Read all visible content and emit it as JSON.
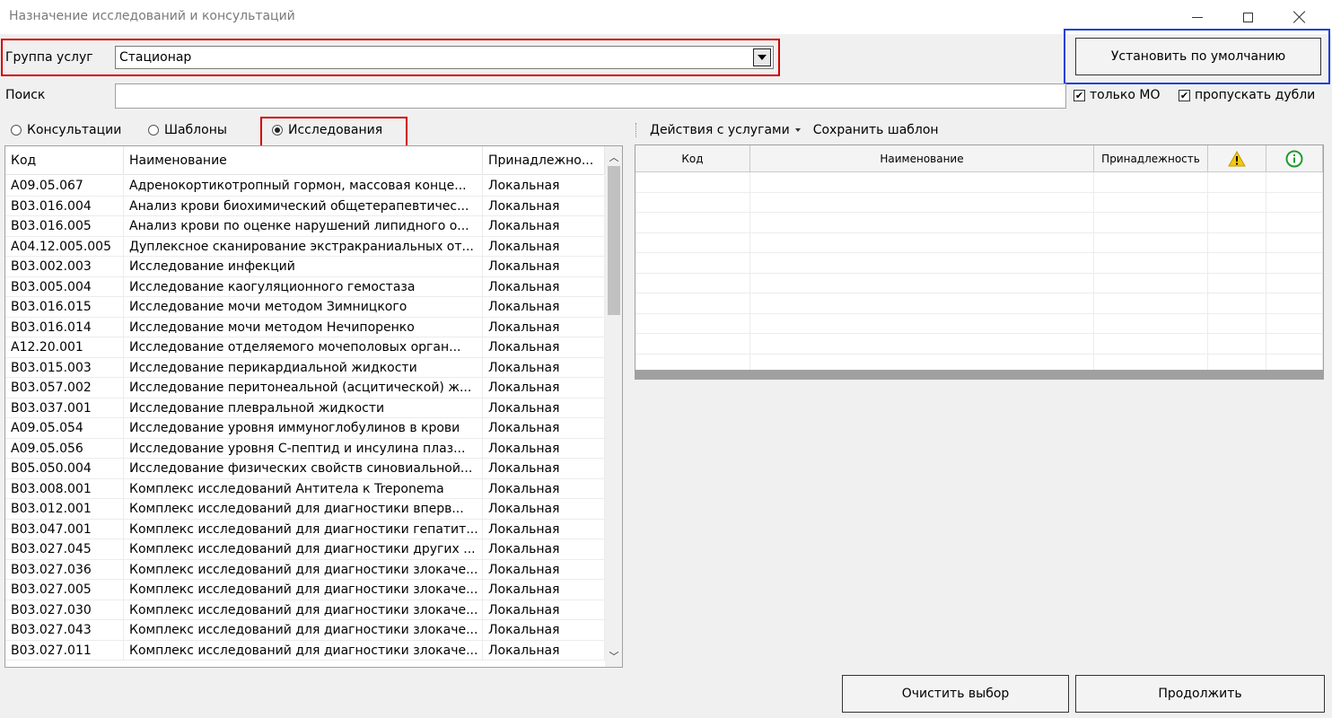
{
  "window": {
    "title": "Назначение исследований и консультаций",
    "controls": {
      "minimize": "minimize",
      "maximize": "maximize",
      "close": "close"
    }
  },
  "service_group": {
    "label": "Группа услуг",
    "value": "Стационар"
  },
  "default_button": "Установить по умолчанию",
  "search": {
    "label": "Поиск",
    "value": "",
    "only_mo": {
      "label": "только МО",
      "checked": true
    },
    "skip_duplicates": {
      "label": "пропускать дубли",
      "checked": true
    }
  },
  "tabs": [
    {
      "label": "Консультации",
      "selected": false
    },
    {
      "label": "Шаблоны",
      "selected": false
    },
    {
      "label": "Исследования",
      "selected": true
    }
  ],
  "left_table": {
    "columns": [
      "Код",
      "Наименование",
      "Принадлежно..."
    ],
    "rows": [
      [
        "A09.05.067",
        "Адренокортикотропный гормон, массовая конце...",
        "Локальная"
      ],
      [
        "B03.016.004",
        "Анализ крови биохимический общетерапевтичес...",
        "Локальная"
      ],
      [
        "B03.016.005",
        "Анализ крови по оценке нарушений липидного о...",
        "Локальная"
      ],
      [
        "A04.12.005.005",
        "Дуплексное сканирование экстракраниальных от...",
        "Локальная"
      ],
      [
        "B03.002.003",
        "Исследование инфекций",
        "Локальная"
      ],
      [
        "B03.005.004",
        "Исследование каогуляционного гемостаза",
        "Локальная"
      ],
      [
        "B03.016.015",
        "Исследование мочи методом Зимницкого",
        "Локальная"
      ],
      [
        "B03.016.014",
        "Исследование мочи методом Нечипоренко",
        "Локальная"
      ],
      [
        "A12.20.001",
        "Исследование отделяемого мочеполовых орган...",
        "Локальная"
      ],
      [
        "B03.015.003",
        "Исследование перикардиальной жидкости",
        "Локальная"
      ],
      [
        "B03.057.002",
        "Исследование перитонеальной (асцитической) ж...",
        "Локальная"
      ],
      [
        "B03.037.001",
        "Исследование плевральной жидкости",
        "Локальная"
      ],
      [
        "A09.05.054",
        "Исследование уровня иммуноглобулинов в крови",
        "Локальная"
      ],
      [
        "A09.05.056",
        "Исследование уровня С-пептид и инсулина плаз...",
        "Локальная"
      ],
      [
        "B05.050.004",
        "Исследование физических свойств синовиальной...",
        "Локальная"
      ],
      [
        "B03.008.001",
        "Комплекс исследований Антитела к Treponema",
        "Локальная"
      ],
      [
        "B03.012.001",
        "Комплекс исследований для диагностики вперв...",
        "Локальная"
      ],
      [
        "B03.047.001",
        "Комплекс исследований для диагностики гепатит...",
        "Локальная"
      ],
      [
        "B03.027.045",
        "Комплекс исследований для диагностики других ...",
        "Локальная"
      ],
      [
        "B03.027.036",
        "Комплекс исследований для диагностики злокаче...",
        "Локальная"
      ],
      [
        "B03.027.005",
        "Комплекс исследований для диагностики злокаче...",
        "Локальная"
      ],
      [
        "B03.027.030",
        "Комплекс исследований для диагностики злокаче...",
        "Локальная"
      ],
      [
        "B03.027.043",
        "Комплекс исследований для диагностики злокаче...",
        "Локальная"
      ],
      [
        "B03.027.011",
        "Комплекс исследований для диагностики злокаче...",
        "Локальная"
      ]
    ]
  },
  "right_panel": {
    "toolbar": {
      "actions_menu": "Действия с услугами",
      "save_template": "Сохранить шаблон"
    },
    "columns": [
      "Код",
      "Наименование",
      "Принадлежность"
    ],
    "warning_icon": "warning-icon",
    "info_icon": "info-icon",
    "colors": {
      "warning": "#f2c811",
      "info": "#1f9a2e"
    }
  },
  "footer": {
    "clear_button": "Очистить выбор",
    "continue_button": "Продолжить"
  },
  "colors": {
    "highlight_red": "#d10000",
    "highlight_blue": "#1e3fd6"
  }
}
